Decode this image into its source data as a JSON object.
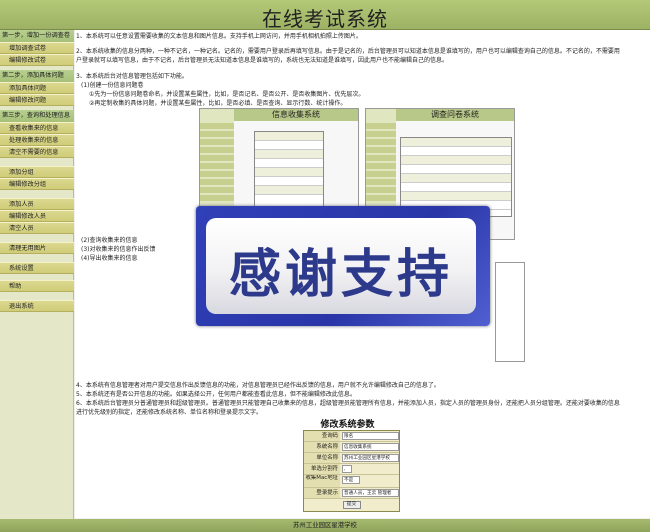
{
  "header": {
    "title": "在线考试系统"
  },
  "sidebar": {
    "sections": [
      {
        "heading": "第一步，增加一份调查卷",
        "items": [
          "增加调查试卷",
          "编辑修改试卷"
        ]
      },
      {
        "heading": "第二步，添加具体问题",
        "items": [
          "添加具体问题",
          "编辑修改问题"
        ]
      },
      {
        "heading": "第三步，查询和处理信息",
        "items": [
          "查看收集来的信息",
          "处理收集来的信息",
          "清空不需要的信息"
        ]
      }
    ],
    "extra_items": [
      "添加分组",
      "编辑修改分组",
      "添加人员",
      "编辑修改人员",
      "清空人员",
      "清理无用图片",
      "系统设置",
      "帮助",
      "退出系统"
    ]
  },
  "main": {
    "p1": "1、本系统可以任意设置需要收集的文本信息和图片信息。支持手机上网访问，并用手机相机拍照上传图片。",
    "p2a": "2、本系统收集的信息分两种，一种不记名，一种记名。记名的，需要用户登录后再填写信息。由于是记名的，后台管理员可以知道本信息是谁填写的，用户也可以编辑查询自己的信息。不记名的，不需要用",
    "p2b": "户登录就可以填写信息，由于不记名，后台管理员无法知道本信息是谁填写的，系统也无法知道是谁填写，因此用户也不能编辑自己的信息。",
    "p3": "3、本系统后台对信息管理包括如下功能。",
    "p3_1": "(1)创建一份信息问题卷",
    "p3_1a": "①先为一份信息问题卷命名，并设置某些属性，比如，是否记名、是否公开、是否收集图片、优先层次。",
    "p3_1b": "②再定制收集的具体问题，并设置某些属性，比如，是否必填、是否查询、显示行数、统计操作。",
    "p3_2": "(2)查询收集来的信息",
    "p3_3": "(3)对收集来的信息作出反馈",
    "p3_4": "(4)导出收集来的信息",
    "p4": "4、本系统有信息管理者对用户提交信息作出反馈信息的功能，对信息管理员已经作出反馈的信息，用户就不允许编辑修改自己的信息了。",
    "p5": "5、本系统还有是否公开信息的功能。如果选择公开，任何用户都能查看此信息，但不能编辑修改此信息。",
    "p6a": "6、本系统后台管理员分普通管理员和超级管理员。普通管理员只能管理自己收集来的信息，超级管理员能管理所有信息，并能添加人员，指定人员的管理员身份，还能把人员分组管理。还能对要收集的信息",
    "p6b": "进行优先级别的指定，还能修改系统名称、单位名称和登录提示文字。",
    "thumb_left_title": "信息收集系统",
    "thumb_right_title": "调查问卷系统"
  },
  "overlay": {
    "text": "感谢支持"
  },
  "settings": {
    "title": "修改系统参数",
    "fields": [
      {
        "label": "查询码",
        "value": "限名"
      },
      {
        "label": "系统名称",
        "value": "信息收集系统"
      },
      {
        "label": "单位名称",
        "value": "苏州工业园区星港学校"
      },
      {
        "label": "单选分割符",
        "value": ","
      },
      {
        "label": "收集Mac地址",
        "value": "不是"
      },
      {
        "label": "登录提示",
        "value": "普通人员，王云 管理者"
      }
    ],
    "submit": "提交"
  },
  "footer": {
    "text": "苏州工业园区星港学校"
  }
}
